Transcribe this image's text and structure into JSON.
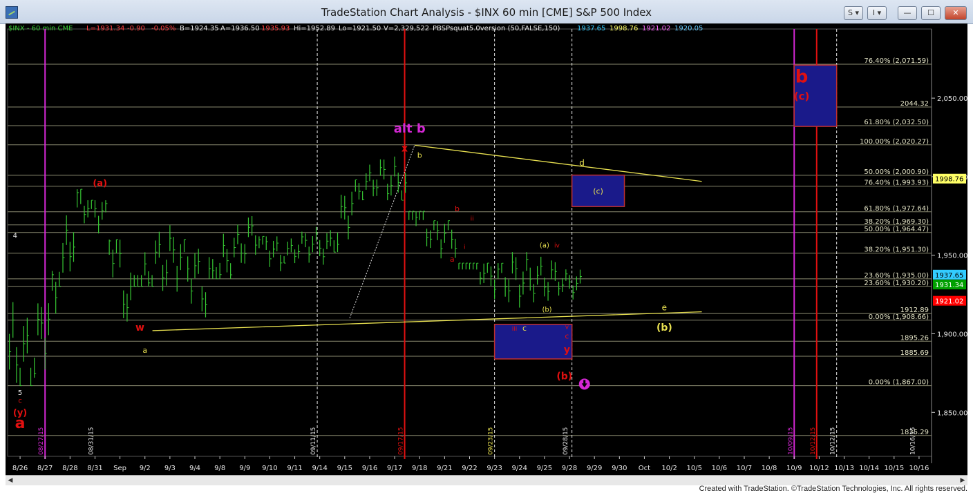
{
  "window": {
    "title": "TradeStation Chart Analysis - $INX 60 min [CME] S&P 500 Index",
    "buttons": [
      "S ▾",
      "I ▾",
      "—",
      "☐",
      "✕"
    ]
  },
  "status_bar": {
    "symbol": "$INX - 60 min  CME",
    "last": "L=1931.34",
    "net_change": "-0.90",
    "pct_change": "-0.05%",
    "bid": "B=1924.35",
    "ask": "A=1936.50",
    "open_like": "1935.93",
    "high": "Hi=1952.89",
    "low": "Lo=1921.50",
    "volume": "V=2,329,522",
    "indicator": "PBSPsquat5.0version (50,FALSE,150)",
    "ind_values": [
      "1937.65",
      "1998.76",
      "1921.02",
      "1920.05"
    ]
  },
  "footer_text": "Created with TradeStation. ©TradeStation Technologies, Inc. All rights reserved.",
  "colors": {
    "background": "#000000",
    "bar_up": "#36c833",
    "bar_down": "#36c833",
    "fib_line": "#f0f0d0",
    "magenta": "#d427d4",
    "red": "#e01010",
    "yellow": "#e8e050",
    "blue_box": "#1a1a8a"
  },
  "chart_data": {
    "type": "ohlc",
    "symbol": "$INX",
    "interval": "60 min",
    "ylim": [
      1822,
      2094
    ],
    "y_ticks": [
      1850,
      1900,
      1950,
      2000,
      2050
    ],
    "y_tick_labels": [
      "1,850.00",
      "1,900.00",
      "1,950.00",
      "2,000.00",
      "2,050.00"
    ],
    "x_ticks": [
      {
        "x": 0.5,
        "label": "8/26"
      },
      {
        "x": 1.5,
        "label": "8/27"
      },
      {
        "x": 2.5,
        "label": "8/28"
      },
      {
        "x": 3.5,
        "label": "8/31"
      },
      {
        "x": 4.5,
        "label": "Sep"
      },
      {
        "x": 5.5,
        "label": "9/2"
      },
      {
        "x": 6.5,
        "label": "9/3"
      },
      {
        "x": 7.5,
        "label": "9/4"
      },
      {
        "x": 8.5,
        "label": "9/8"
      },
      {
        "x": 9.5,
        "label": "9/9"
      },
      {
        "x": 10.5,
        "label": "9/10"
      },
      {
        "x": 11.5,
        "label": "9/11"
      },
      {
        "x": 12.5,
        "label": "9/14"
      },
      {
        "x": 13.5,
        "label": "9/15"
      },
      {
        "x": 14.5,
        "label": "9/16"
      },
      {
        "x": 15.5,
        "label": "9/17"
      },
      {
        "x": 16.5,
        "label": "9/18"
      },
      {
        "x": 17.5,
        "label": "9/21"
      },
      {
        "x": 18.5,
        "label": "9/22"
      },
      {
        "x": 19.5,
        "label": "9/23"
      },
      {
        "x": 20.5,
        "label": "9/24"
      },
      {
        "x": 21.5,
        "label": "9/25"
      },
      {
        "x": 22.5,
        "label": "9/28"
      },
      {
        "x": 23.5,
        "label": "9/29"
      },
      {
        "x": 24.5,
        "label": "9/30"
      },
      {
        "x": 25.5,
        "label": "Oct"
      },
      {
        "x": 26.5,
        "label": "10/2"
      },
      {
        "x": 27.5,
        "label": "10/5"
      },
      {
        "x": 28.5,
        "label": "10/6"
      },
      {
        "x": 29.5,
        "label": "10/7"
      },
      {
        "x": 30.5,
        "label": "10/8"
      },
      {
        "x": 31.5,
        "label": "10/9"
      },
      {
        "x": 32.5,
        "label": "10/12"
      },
      {
        "x": 33.5,
        "label": "10/13"
      },
      {
        "x": 34.5,
        "label": "10/14"
      },
      {
        "x": 35.5,
        "label": "10/15"
      },
      {
        "x": 36.5,
        "label": "10/16"
      }
    ],
    "day_closes": [
      1880,
      1925,
      1985,
      1975,
      1915,
      1945,
      1950,
      1928,
      1950,
      1965,
      1948,
      1958,
      1955,
      1990,
      2000,
      1994,
      1964,
      1963,
      1940,
      1936,
      1935,
      1934,
      1931
    ],
    "day_highs": [
      1945,
      1940,
      1992,
      1985,
      1960,
      1975,
      1972,
      1960,
      1980,
      1975,
      1962,
      1965,
      1968,
      1998,
      2012,
      2021,
      1978,
      1972,
      1945,
      1945,
      1952,
      1953,
      1941
    ],
    "day_lows": [
      1867,
      1872,
      1930,
      1955,
      1903,
      1930,
      1920,
      1910,
      1935,
      1940,
      1935,
      1945,
      1942,
      1952,
      1985,
      1985,
      1948,
      1938,
      1928,
      1910,
      1908,
      1920,
      1921
    ],
    "fib_levels": [
      {
        "value": 2071.59,
        "label": "76.40% (2,071.59)"
      },
      {
        "value": 2044.32,
        "label": "2044.32"
      },
      {
        "value": 2032.5,
        "label": "61.80% (2,032.50)"
      },
      {
        "value": 2020.27,
        "label": "100.00% (2,020.27)"
      },
      {
        "value": 2000.9,
        "label": "50.00% (2,000.90)"
      },
      {
        "value": 1993.93,
        "label": "76.40% (1,993.93)"
      },
      {
        "value": 1977.64,
        "label": "61.80% (1,977.64)"
      },
      {
        "value": 1969.3,
        "label": "38.20% (1,969.30)"
      },
      {
        "value": 1964.47,
        "label": "50.00% (1,964.47)"
      },
      {
        "value": 1951.3,
        "label": "38.20% (1,951.30)"
      },
      {
        "value": 1935.0,
        "label": "23.60% (1,935.00)"
      },
      {
        "value": 1930.2,
        "label": "23.60% (1,930.20)"
      },
      {
        "value": 1912.89,
        "label": "1912.89"
      },
      {
        "value": 1908.66,
        "label": "0.00% (1,908.66)"
      },
      {
        "value": 1895.26,
        "label": "1895.26"
      },
      {
        "value": 1885.69,
        "label": "1885.69"
      },
      {
        "value": 1867.0,
        "label": "0.00% (1,867.00)"
      },
      {
        "value": 1835.29,
        "label": "1835.29"
      }
    ],
    "price_tags": [
      {
        "value": 1998.76,
        "label": "1998.76",
        "bg": "#ffff66",
        "fg": "#000000"
      },
      {
        "value": 1937.65,
        "label": "1937.65",
        "bg": "#33ccff",
        "fg": "#000000"
      },
      {
        "value": 1931.34,
        "label": "1931.34",
        "bg": "#00a000",
        "fg": "#ffffff"
      },
      {
        "value": 1921.02,
        "label": "1921.02",
        "bg": "#ff0000",
        "fg": "#ffffff"
      }
    ],
    "vertical_date_labels": [
      {
        "x": 1.5,
        "label": "08/27/15",
        "color": "magenta"
      },
      {
        "x": 3.5,
        "label": "08/31/15",
        "color": "white"
      },
      {
        "x": 12.4,
        "label": "09/11/15",
        "color": "white"
      },
      {
        "x": 15.9,
        "label": "09/17/15",
        "color": "red"
      },
      {
        "x": 19.5,
        "label": "09/23/15",
        "color": "yellow"
      },
      {
        "x": 22.5,
        "label": "09/28/15",
        "color": "white"
      },
      {
        "x": 31.5,
        "label": "10/09/15",
        "color": "magenta"
      },
      {
        "x": 32.4,
        "label": "10/12/15",
        "color": "red"
      },
      {
        "x": 33.2,
        "label": "10/12/15",
        "color": "white"
      },
      {
        "x": 36.4,
        "label": "10/16/15",
        "color": "white"
      }
    ],
    "wave_labels": [
      {
        "x": 0.5,
        "y": 1840,
        "text": "a",
        "color": "red",
        "size": 22
      },
      {
        "x": 0.5,
        "y": 1848,
        "text": "(y)",
        "color": "red",
        "size": 13
      },
      {
        "x": 0.5,
        "y": 1856,
        "text": "c",
        "color": "red",
        "size": 10
      },
      {
        "x": 0.5,
        "y": 1861,
        "text": "5",
        "color": "white",
        "size": 10
      },
      {
        "x": 0.3,
        "y": 1961,
        "text": "4",
        "color": "white",
        "size": 10
      },
      {
        "x": 3.7,
        "y": 1994,
        "text": "(a)",
        "color": "red",
        "size": 13
      },
      {
        "x": 5.3,
        "y": 1902,
        "text": "w",
        "color": "red",
        "size": 14
      },
      {
        "x": 5.5,
        "y": 1888,
        "text": "a",
        "color": "yellow",
        "size": 11
      },
      {
        "x": 16.1,
        "y": 2028,
        "text": "alt b",
        "color": "magenta",
        "size": 18
      },
      {
        "x": 15.9,
        "y": 2016,
        "text": "x",
        "color": "red",
        "size": 14
      },
      {
        "x": 16.5,
        "y": 2012,
        "text": "b",
        "color": "yellow",
        "size": 11
      },
      {
        "x": 23.0,
        "y": 2007,
        "text": "d",
        "color": "yellow",
        "size": 12
      },
      {
        "x": 18.0,
        "y": 1978,
        "text": "b",
        "color": "red",
        "size": 11
      },
      {
        "x": 18.6,
        "y": 1972,
        "text": "ii",
        "color": "red",
        "size": 9
      },
      {
        "x": 17.8,
        "y": 1946,
        "text": "a",
        "color": "red",
        "size": 11
      },
      {
        "x": 18.3,
        "y": 1954,
        "text": "i",
        "color": "red",
        "size": 9
      },
      {
        "x": 21.5,
        "y": 1955,
        "text": "(a)",
        "color": "yellow",
        "size": 10
      },
      {
        "x": 22.0,
        "y": 1955,
        "text": "iv",
        "color": "red",
        "size": 9
      },
      {
        "x": 21.6,
        "y": 1914,
        "text": "(b)",
        "color": "yellow",
        "size": 10
      },
      {
        "x": 20.3,
        "y": 1902,
        "text": "iii",
        "color": "red",
        "size": 9
      },
      {
        "x": 20.7,
        "y": 1902,
        "text": "c",
        "color": "yellow",
        "size": 11
      },
      {
        "x": 22.4,
        "y": 1903,
        "text": "v",
        "color": "red",
        "size": 9
      },
      {
        "x": 22.4,
        "y": 1897,
        "text": "c",
        "color": "red",
        "size": 11
      },
      {
        "x": 22.4,
        "y": 1888,
        "text": "y",
        "color": "red",
        "size": 14
      },
      {
        "x": 22.3,
        "y": 1871,
        "text": "(b)",
        "color": "red",
        "size": 14
      },
      {
        "x": 26.3,
        "y": 1915,
        "text": "e",
        "color": "yellow",
        "size": 12
      },
      {
        "x": 26.3,
        "y": 1902,
        "text": "(b)",
        "color": "yellow",
        "size": 14
      },
      {
        "x": 31.8,
        "y": 2060,
        "text": "b",
        "color": "red",
        "size": 26
      },
      {
        "x": 31.8,
        "y": 2049,
        "text": "(c)",
        "color": "red",
        "size": 15
      }
    ],
    "boxes": [
      {
        "x0": 22.6,
        "x1": 24.7,
        "y0": 1981,
        "y1": 2001,
        "label": "(c)"
      },
      {
        "x0": 19.5,
        "x1": 22.6,
        "y0": 1884,
        "y1": 1906,
        "label": ""
      },
      {
        "x0": 31.5,
        "x1": 33.2,
        "y0": 2032,
        "y1": 2071,
        "label": ""
      }
    ],
    "trendlines": [
      {
        "x0": 16.3,
        "y0": 2020,
        "x1": 27.8,
        "y1": 1997,
        "color": "yellow"
      },
      {
        "x0": 5.8,
        "y0": 1902,
        "x1": 27.8,
        "y1": 1914,
        "color": "yellow"
      },
      {
        "x0": 13.7,
        "y0": 1910,
        "x1": 16.3,
        "y1": 2020,
        "color": "white",
        "dash": true
      }
    ],
    "vertical_lines": [
      {
        "x": 1.5,
        "color": "magenta",
        "dash": false
      },
      {
        "x": 12.4,
        "color": "white",
        "dash": true
      },
      {
        "x": 15.9,
        "color": "red",
        "dash": false
      },
      {
        "x": 19.5,
        "color": "white",
        "dash": true
      },
      {
        "x": 22.6,
        "color": "white",
        "dash": true
      },
      {
        "x": 31.5,
        "color": "magenta",
        "dash": false
      },
      {
        "x": 32.4,
        "color": "red",
        "dash": false
      },
      {
        "x": 33.2,
        "color": "white",
        "dash": true
      }
    ],
    "down_arrow": {
      "x": 23.1,
      "y": 1868
    }
  }
}
